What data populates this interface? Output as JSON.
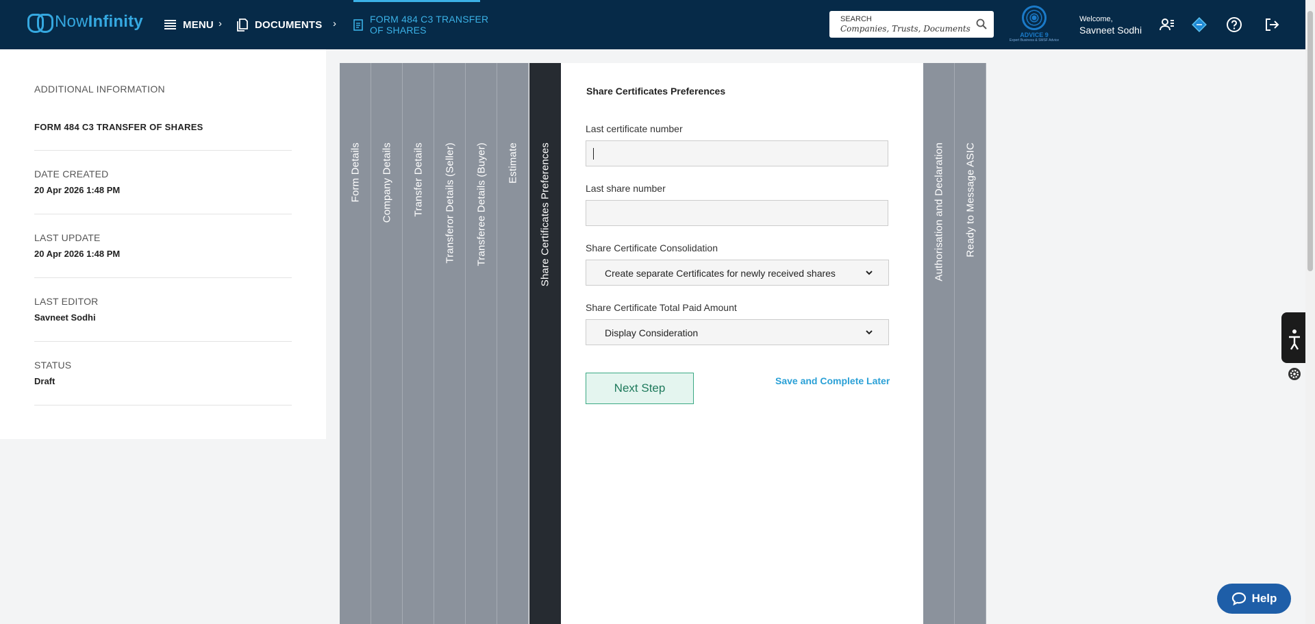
{
  "header": {
    "logo": {
      "text_part1": "Now",
      "text_part2": "Infinity"
    },
    "nav": {
      "menu_label": "MENU",
      "documents_label": "DOCUMENTS",
      "separator": "›",
      "current_line1": "FORM 484 C3 TRANSFER",
      "current_line2": "OF SHARES"
    },
    "search": {
      "label": "SEARCH",
      "placeholder": "Companies,  Trusts,  Documents"
    },
    "brand": {
      "name": "ADVICE 9",
      "tagline": "Expert Business & SMSF Advice"
    },
    "welcome": {
      "greeting": "Welcome,",
      "user": "Savneet Sodhi"
    },
    "icons": [
      "user-manage-icon",
      "diamond-icon",
      "help-circle-icon",
      "logout-icon"
    ]
  },
  "sidebar": {
    "title": "ADDITIONAL INFORMATION",
    "form_name": "FORM 484 C3 TRANSFER OF SHARES",
    "fields": [
      {
        "label": "DATE CREATED",
        "value": "20 Apr 2026 1:48 PM"
      },
      {
        "label": "LAST UPDATE",
        "value": "20 Apr 2026 1:48 PM"
      },
      {
        "label": "LAST EDITOR",
        "value": "Savneet Sodhi"
      },
      {
        "label": "STATUS",
        "value": "Draft"
      }
    ]
  },
  "steps": [
    {
      "label": "Form Details",
      "active": false
    },
    {
      "label": "Company Details",
      "active": false
    },
    {
      "label": "Transfer Details",
      "active": false
    },
    {
      "label": "Transferor Details (Seller)",
      "active": false
    },
    {
      "label": "Transferee Details (Buyer)",
      "active": false
    },
    {
      "label": "Estimate",
      "active": false
    },
    {
      "label": "Share Certificates Preferences",
      "active": true
    },
    {
      "label": "Authorisation and Declaration",
      "active": false
    },
    {
      "label": "Ready to Message ASIC",
      "active": false
    }
  ],
  "form": {
    "title": "Share Certificates Preferences",
    "last_certificate": {
      "label": "Last certificate number",
      "value": ""
    },
    "last_share": {
      "label": "Last share number",
      "value": ""
    },
    "consolidation": {
      "label": "Share Certificate Consolidation",
      "selected": "Create separate Certificates for newly received shares"
    },
    "paid_amount": {
      "label": "Share Certificate Total Paid Amount",
      "selected": "Display Consideration"
    },
    "next_label": "Next Step",
    "save_later_label": "Save and Complete Later"
  },
  "help": {
    "label": "Help"
  },
  "colors": {
    "topbar": "#062a48",
    "accent": "#3bb1e6",
    "tab_inactive": "#8b929c",
    "tab_active": "#262b31",
    "button_green": "#3aa883",
    "help_blue": "#1e5ea8"
  }
}
